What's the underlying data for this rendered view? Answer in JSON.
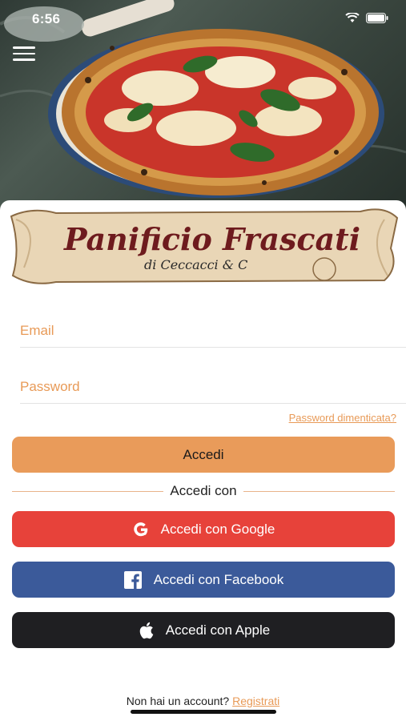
{
  "status_bar": {
    "time": "6:56",
    "icons": [
      "wifi-icon",
      "battery-icon"
    ]
  },
  "header": {
    "menu_icon": "hamburger-menu-icon"
  },
  "logo": {
    "title": "Panificio Frascati",
    "subtitle": "di  Ceccacci & C"
  },
  "form": {
    "email_placeholder": "Email",
    "password_placeholder": "Password",
    "forgot_password": "Password dimenticata?",
    "login_button": "Accedi"
  },
  "social": {
    "divider_label": "Accedi con",
    "google_label": "Accedi con Google",
    "facebook_label": "Accedi con Facebook",
    "apple_label": "Accedi con Apple"
  },
  "footer": {
    "prompt": "Non hai un account?",
    "signup_link": "Registrati"
  },
  "colors": {
    "accent": "#e99b5a",
    "google": "#e7423a",
    "facebook": "#3b5a9a",
    "apple": "#1f1f22"
  }
}
